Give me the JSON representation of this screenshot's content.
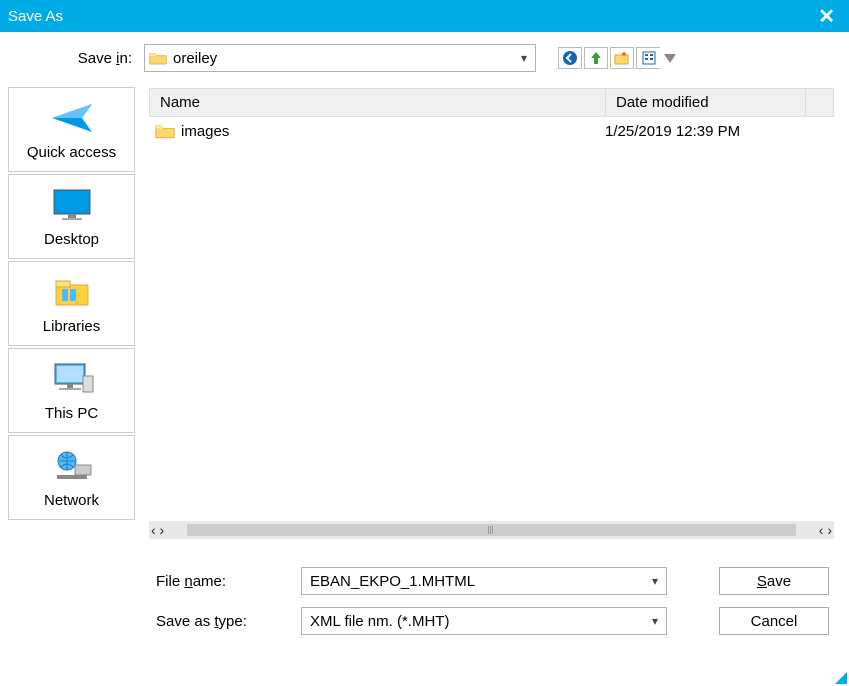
{
  "title": "Save As",
  "savein": {
    "label_pre": "Save ",
    "label_key": "i",
    "label_post": "n:",
    "selected": "oreiley"
  },
  "places": [
    {
      "label": "Quick access"
    },
    {
      "label": "Desktop"
    },
    {
      "label": "Libraries"
    },
    {
      "label": "This PC"
    },
    {
      "label": "Network"
    }
  ],
  "columns": {
    "name": "Name",
    "date": "Date modified"
  },
  "rows": [
    {
      "name": "images",
      "date": "1/25/2019 12:39 PM"
    }
  ],
  "filename": {
    "label_pre": "File ",
    "label_key": "n",
    "label_post": "ame:",
    "value": "EBAN_EKPO_1.MHTML"
  },
  "filetype": {
    "label_pre": "Save as ",
    "label_key": "t",
    "label_post": "ype:",
    "value": "XML file nm. (*.MHT)"
  },
  "buttons": {
    "save_key": "S",
    "save_rest": "ave",
    "cancel": "Cancel"
  }
}
